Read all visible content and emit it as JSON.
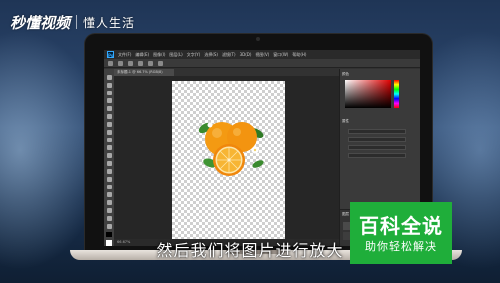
{
  "watermark": {
    "logo_text": "秒懂视频",
    "tagline": "懂人生活"
  },
  "photoshop": {
    "menu": [
      "文件(F)",
      "编辑(E)",
      "图像(I)",
      "图层(L)",
      "文字(Y)",
      "选择(S)",
      "滤镜(T)",
      "3D(D)",
      "视图(V)",
      "窗口(W)",
      "帮助(H)"
    ],
    "document_tab": "未标题-1 @ 66.7% (RGB/8)",
    "status_text": "66.67%",
    "panel_color_tab": "颜色",
    "panel_properties_tab": "属性",
    "panel_layers_tab": "图层",
    "colors": {
      "foreground": "#000000",
      "background": "#ffffff",
      "accent": "#31a8ff"
    }
  },
  "subtitle": "然后我们将图片进行放大",
  "brand_badge": {
    "title": "百科全说",
    "subtitle": "助你轻松解决",
    "color": "#1fae3a"
  }
}
